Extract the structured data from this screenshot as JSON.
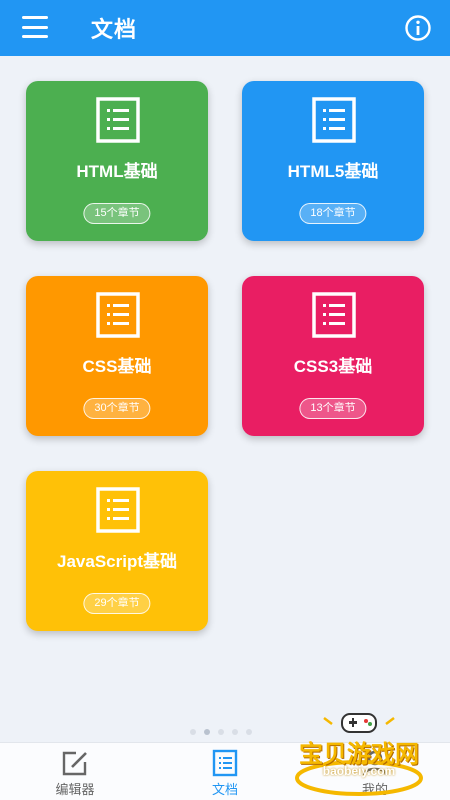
{
  "header": {
    "title": "文档",
    "menu_icon": "menu-icon",
    "info_icon": "info-icon"
  },
  "cards": [
    {
      "title": "HTML基础",
      "chapters": "15个章节",
      "color": "#4caf50"
    },
    {
      "title": "HTML5基础",
      "chapters": "18个章节",
      "color": "#2196f3"
    },
    {
      "title": "CSS基础",
      "chapters": "30个章节",
      "color": "#ff9800"
    },
    {
      "title": "CSS3基础",
      "chapters": "13个章节",
      "color": "#e91e63"
    },
    {
      "title": "JavaScript基础",
      "chapters": "29个章节",
      "color": "#ffc107"
    }
  ],
  "pager": {
    "total": 5,
    "active": 1
  },
  "bottom_nav": [
    {
      "label": "编辑器",
      "icon": "edit-icon",
      "active": false
    },
    {
      "label": "文档",
      "icon": "document-icon",
      "active": true
    },
    {
      "label": "我的",
      "icon": "person-icon",
      "active": false
    }
  ],
  "watermark": {
    "text": "宝贝游戏网",
    "sub": "baobeiy.com"
  },
  "colors": {
    "primary": "#2196f3",
    "background": "#eef2f8"
  }
}
